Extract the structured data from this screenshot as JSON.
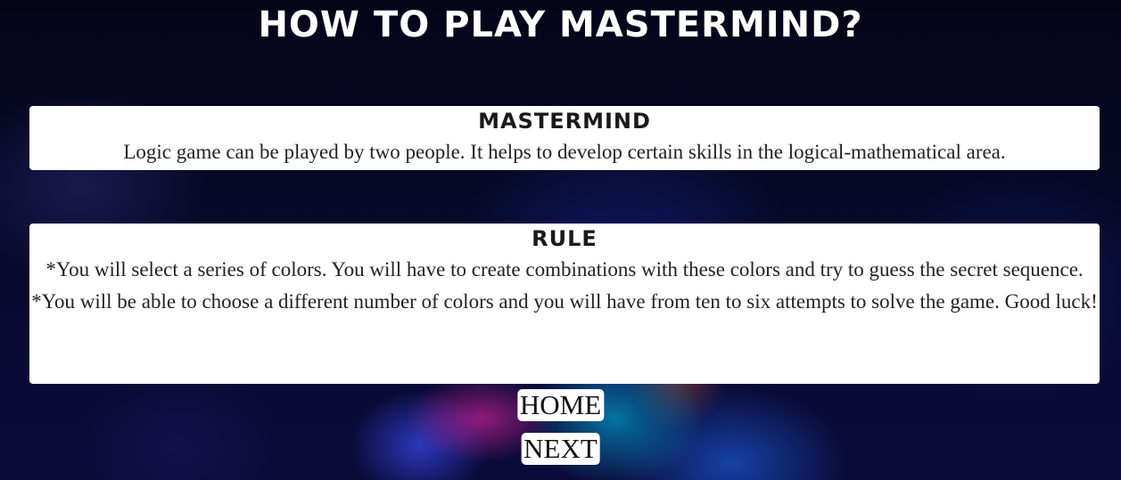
{
  "page": {
    "title": "HOW TO PLAY MASTERMIND?"
  },
  "about": {
    "heading": "MASTERMIND",
    "text": "Logic game can be played by two people. It helps to develop certain skills in the logical-mathematical area."
  },
  "rules": {
    "heading": "RULE",
    "items": [
      "*You will select a series of colors. You will have to create combinations with these colors and try to guess the secret sequence.",
      "*You will be able to choose a different number of colors and you will have from ten to six attempts to solve the game. Good luck!"
    ]
  },
  "nav": {
    "home_label": "HOME",
    "next_label": "NEXT"
  }
}
